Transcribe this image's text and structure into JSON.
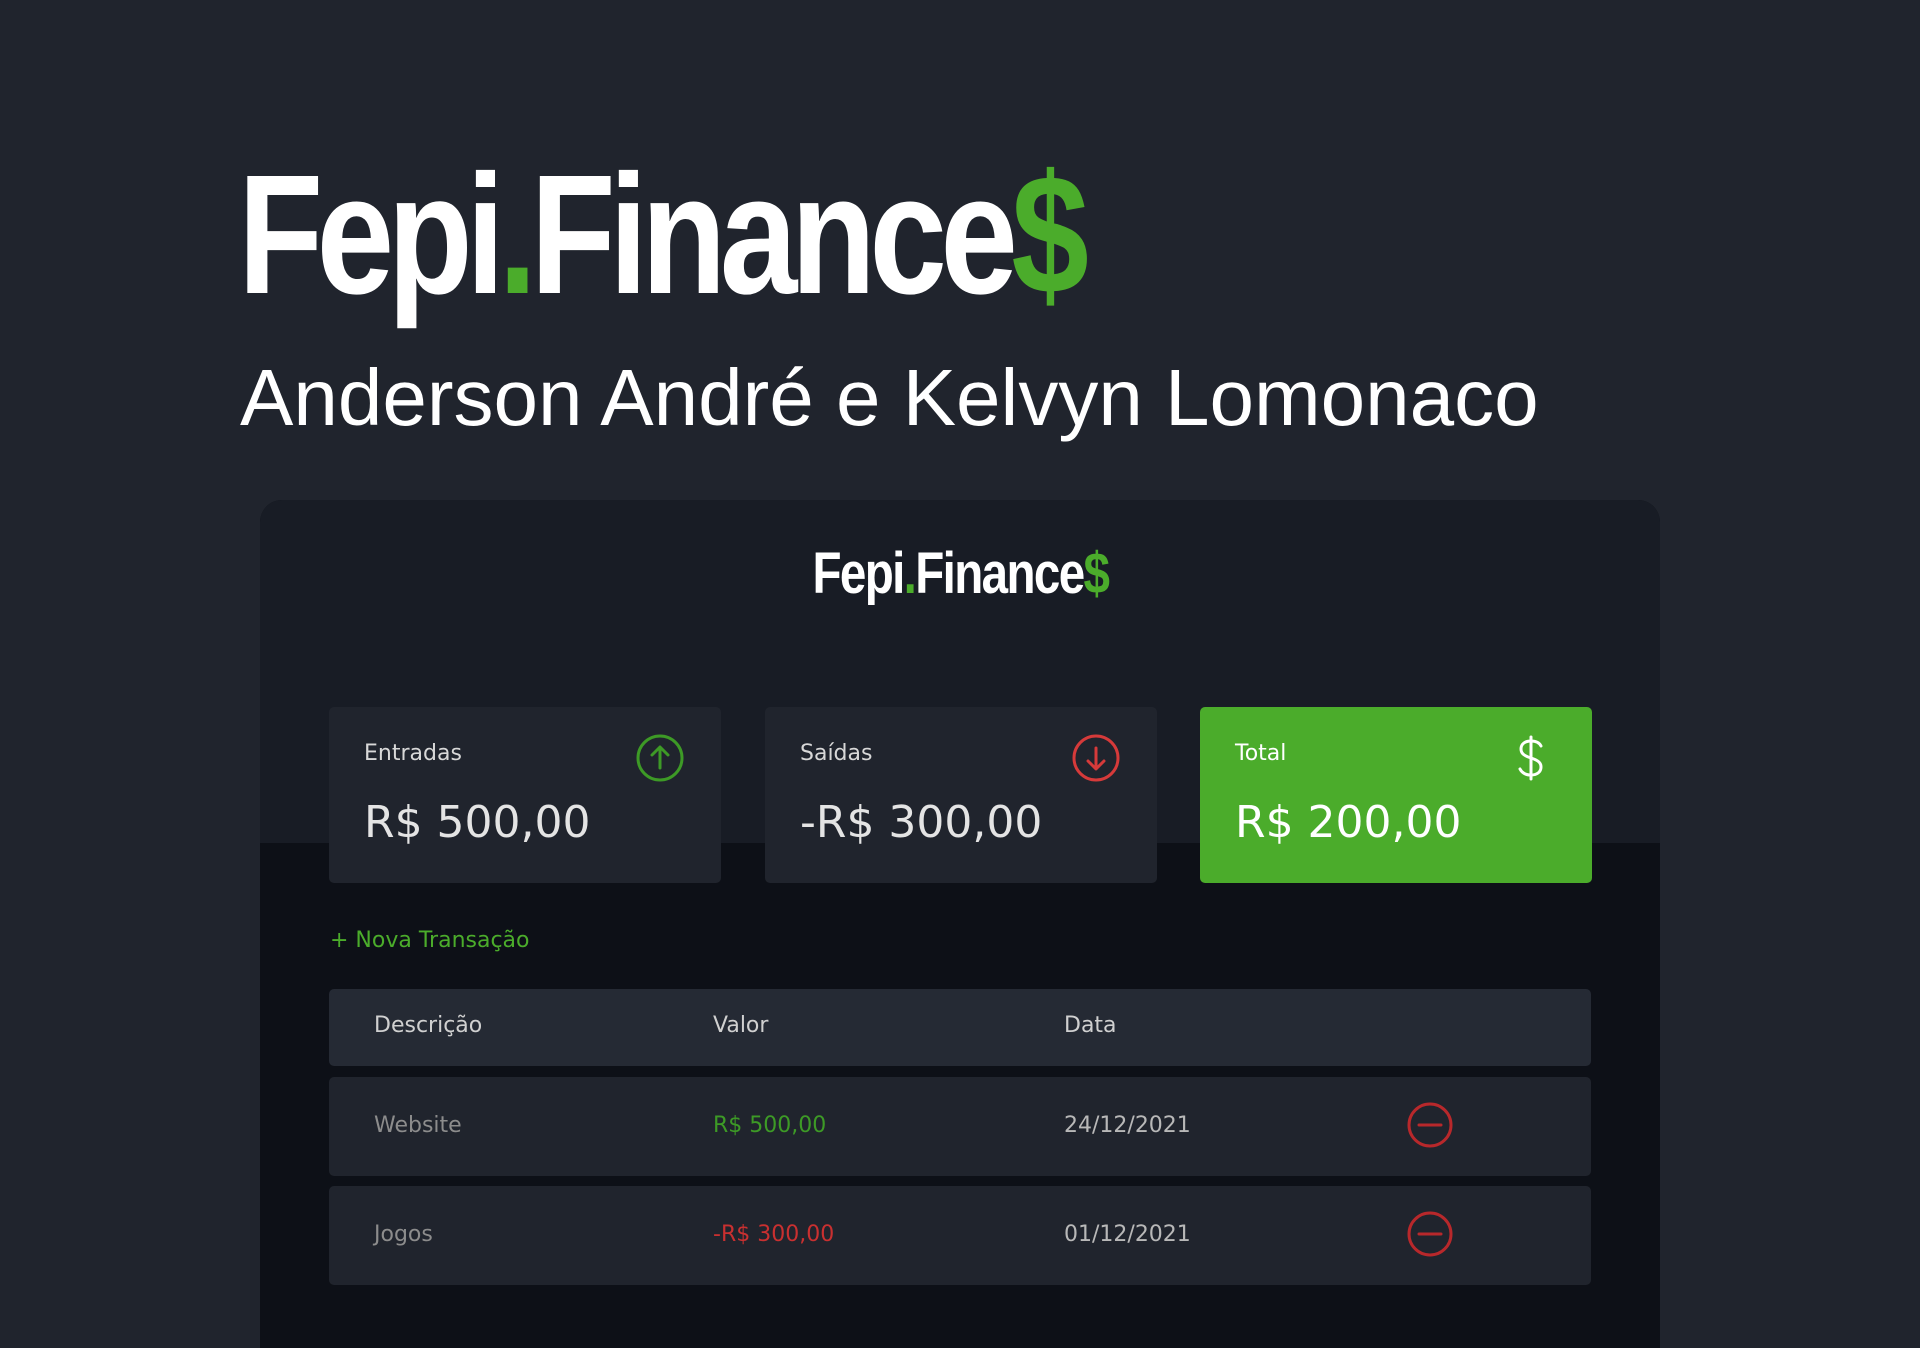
{
  "hero": {
    "title_main": "Fepi",
    "title_dot": ".",
    "title_name": "Finance",
    "title_symbol": "$",
    "subtitle": "Anderson André e Kelvyn Lomonaco"
  },
  "app": {
    "logo_main": "Fepi",
    "logo_dot": ".",
    "logo_name": "Finance",
    "logo_symbol": "$",
    "cards": {
      "income": {
        "label": "Entradas",
        "value": "R$ 500,00",
        "icon": "arrow-up-circle-icon"
      },
      "expense": {
        "label": "Saídas",
        "value": "-R$ 300,00",
        "icon": "arrow-down-circle-icon"
      },
      "total": {
        "label": "Total",
        "value": "R$ 200,00",
        "icon": "dollar-sign-icon"
      }
    },
    "new_transaction_label": "+ Nova Transação",
    "table": {
      "headers": {
        "description": "Descrição",
        "value": "Valor",
        "date": "Data"
      },
      "rows": [
        {
          "description": "Website",
          "value": "R$ 500,00",
          "type": "income",
          "date": "24/12/2021"
        },
        {
          "description": "Jogos",
          "value": "-R$ 300,00",
          "type": "expense",
          "date": "01/12/2021"
        }
      ]
    }
  },
  "colors": {
    "background": "#20242d",
    "accent_green": "#4bac2b",
    "expense_red": "#c93030",
    "card_bg": "#20242d"
  }
}
